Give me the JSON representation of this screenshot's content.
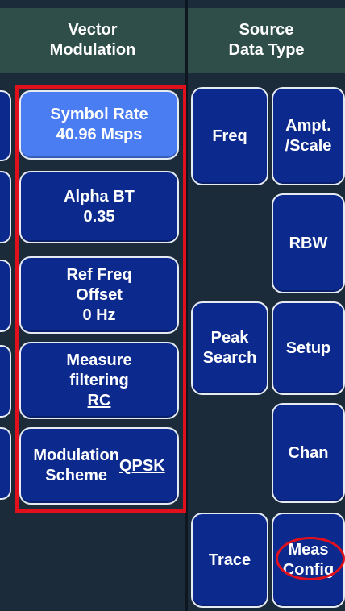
{
  "left_panel": {
    "header": "Vector\nModulation",
    "buttons": [
      {
        "label": "Symbol Rate\n40.96 Msps"
      },
      {
        "label": "Alpha BT\n0.35"
      },
      {
        "label": "Ref Freq\nOffset\n0 Hz"
      },
      {
        "label": "Measure\nfiltering\nRC"
      },
      {
        "label": "Modulation\nScheme\nQPSK"
      }
    ]
  },
  "right_panel": {
    "header": "Source\nData Type",
    "col1": [
      {
        "label": "Freq"
      },
      {
        "label": "Peak\nSearch"
      },
      {
        "label": "Trace"
      }
    ],
    "col2": [
      {
        "label": "Ampt.\n/Scale"
      },
      {
        "label": "RBW"
      },
      {
        "label": "Setup"
      },
      {
        "label": "Chan"
      },
      {
        "label": "Meas\nConfig"
      }
    ]
  },
  "colors": {
    "button_blue": "#0c2a8e",
    "active_blue": "#4a7cf2",
    "header_green": "#2f4e4a",
    "highlight_red": "#e2101c"
  }
}
